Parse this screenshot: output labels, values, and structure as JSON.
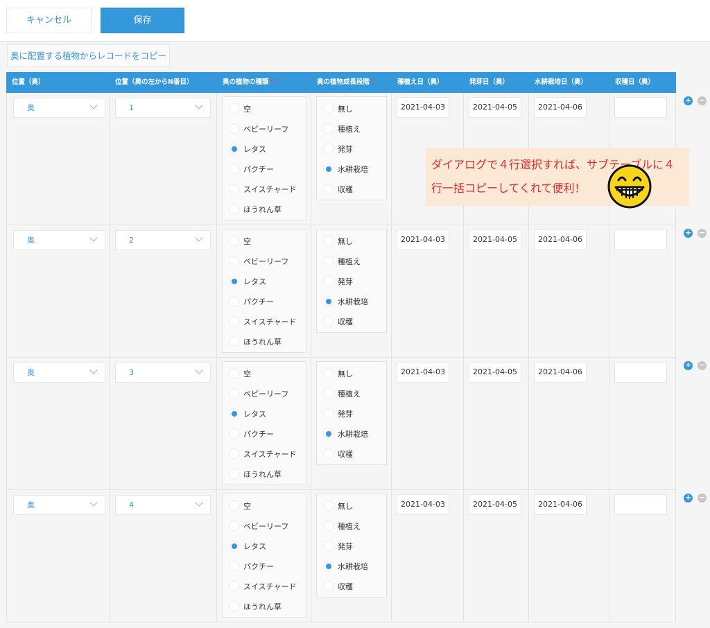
{
  "toolbar": {
    "cancel_label": "キャンセル",
    "save_label": "保存"
  },
  "copy_button_label": "奥に配置する植物からレコードをコピー",
  "columns": {
    "position": "位置（奥）",
    "position_n": "位置（奥の左からN番目）",
    "plant_type": "奥の植物の種類",
    "growth_stage": "奥の植物成長段階",
    "planting_date": "種植え日（奥）",
    "germination_date": "発芽日（奥）",
    "hydro_date": "水耕栽培日（奥）",
    "harvest_date": "収穫日（奥）",
    "required_mark": "*"
  },
  "plant_options": [
    "空",
    "ベビーリーフ",
    "レタス",
    "パクチー",
    "スイスチャード",
    "ほうれん草"
  ],
  "stage_options": [
    "無し",
    "種植え",
    "発芽",
    "水耕栽培",
    "収穫"
  ],
  "rows": [
    {
      "position": "奥",
      "position_n": "1",
      "plant": "レタス",
      "stage": "水耕栽培",
      "planting_date": "2021-04-03",
      "germination_date": "2021-04-05",
      "hydro_date": "2021-04-06",
      "harvest_date": ""
    },
    {
      "position": "奥",
      "position_n": "2",
      "plant": "レタス",
      "stage": "水耕栽培",
      "planting_date": "2021-04-03",
      "germination_date": "2021-04-05",
      "hydro_date": "2021-04-06",
      "harvest_date": ""
    },
    {
      "position": "奥",
      "position_n": "3",
      "plant": "レタス",
      "stage": "水耕栽培",
      "planting_date": "2021-04-03",
      "germination_date": "2021-04-05",
      "hydro_date": "2021-04-06",
      "harvest_date": ""
    },
    {
      "position": "奥",
      "position_n": "4",
      "plant": "レタス",
      "stage": "水耕栽培",
      "planting_date": "2021-04-03",
      "germination_date": "2021-04-05",
      "hydro_date": "2021-04-06",
      "harvest_date": ""
    }
  ],
  "row_buttons": {
    "add": "+",
    "remove": "−"
  },
  "annotation": {
    "line1": "ダイアログで４行選択すれば、サブテーブルに４",
    "line2": "行一括コピーしてくれて便利！"
  },
  "colors": {
    "accent": "#3498db",
    "annotation_text": "#d72c2c",
    "annotation_bg": "#fbe9d6"
  },
  "icons": {
    "emoji": "grinning-face-icon",
    "chevron": "chevron-down-icon"
  }
}
